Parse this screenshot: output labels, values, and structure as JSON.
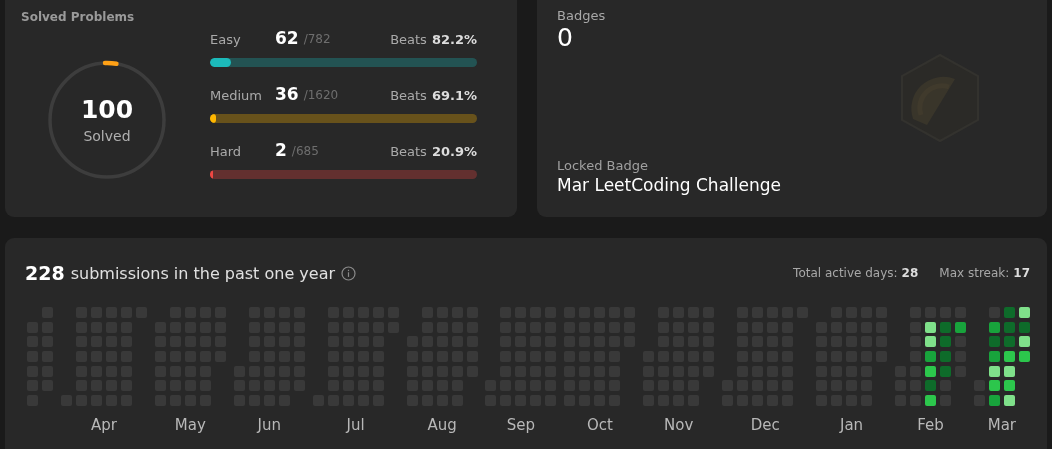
{
  "solved": {
    "title": "Solved Problems",
    "count": "100",
    "caption": "Solved",
    "level": 0.032,
    "difficulties": [
      {
        "label": "Easy",
        "count": "62",
        "total": "/782",
        "beats_label": "Beats",
        "beats": "82.2%",
        "color": "#1cbaba",
        "level": 0.08
      },
      {
        "label": "Medium",
        "count": "36",
        "total": "/1620",
        "beats_label": "Beats",
        "beats": "69.1%",
        "color": "#ffb700",
        "level": 0.022
      },
      {
        "label": "Hard",
        "count": "2",
        "total": "/685",
        "beats_label": "Beats",
        "beats": "20.9%",
        "color": "#ef4743",
        "level": 0.012
      }
    ]
  },
  "badges": {
    "title": "Badges",
    "count": "0",
    "locked_label": "Locked Badge",
    "locked_name": "Mar LeetCoding Challenge"
  },
  "submissions": {
    "count": "228",
    "text": "submissions in the past one year",
    "active_label": "Total active days:",
    "active_days": "28",
    "streak_label": "Max streak:",
    "streak": "17",
    "months": [
      {
        "weeks": [
          [
            {
              "color": "#393939"
            },
            {
              "color": "#393939"
            },
            {
              "color": "#393939"
            },
            {
              "color": "#393939"
            },
            {
              "color": "#393939"
            },
            {
              "color": "#393939"
            }
          ],
          [
            {
              "color": "#393939"
            },
            {
              "color": "#393939"
            },
            {
              "color": "#393939"
            },
            {
              "color": "#393939"
            },
            {
              "color": "#393939"
            },
            {
              "color": "#393939"
            }
          ]
        ]
      },
      {
        "label": "Apr",
        "weeks": [
          [
            {
              "color": "#393939"
            }
          ],
          [
            {
              "color": "#393939"
            },
            {
              "color": "#393939"
            },
            {
              "color": "#393939"
            },
            {
              "color": "#393939"
            },
            {
              "color": "#393939"
            },
            {
              "color": "#393939"
            },
            {
              "color": "#393939"
            }
          ],
          [
            {
              "color": "#393939"
            },
            {
              "color": "#393939"
            },
            {
              "color": "#393939"
            },
            {
              "color": "#393939"
            },
            {
              "color": "#393939"
            },
            {
              "color": "#393939"
            },
            {
              "color": "#393939"
            }
          ],
          [
            {
              "color": "#393939"
            },
            {
              "color": "#393939"
            },
            {
              "color": "#393939"
            },
            {
              "color": "#393939"
            },
            {
              "color": "#393939"
            },
            {
              "color": "#393939"
            },
            {
              "color": "#393939"
            }
          ],
          [
            {
              "color": "#393939"
            },
            {
              "color": "#393939"
            },
            {
              "color": "#393939"
            },
            {
              "color": "#393939"
            },
            {
              "color": "#393939"
            },
            {
              "color": "#393939"
            },
            {
              "color": "#393939"
            }
          ],
          [
            {
              "color": "#393939"
            }
          ]
        ]
      },
      {
        "label": "May",
        "weeks": [
          [
            {
              "color": "#393939"
            },
            {
              "color": "#393939"
            },
            {
              "color": "#393939"
            },
            {
              "color": "#393939"
            },
            {
              "color": "#393939"
            },
            {
              "color": "#393939"
            }
          ],
          [
            {
              "color": "#393939"
            },
            {
              "color": "#393939"
            },
            {
              "color": "#393939"
            },
            {
              "color": "#393939"
            },
            {
              "color": "#393939"
            },
            {
              "color": "#393939"
            },
            {
              "color": "#393939"
            }
          ],
          [
            {
              "color": "#393939"
            },
            {
              "color": "#393939"
            },
            {
              "color": "#393939"
            },
            {
              "color": "#393939"
            },
            {
              "color": "#393939"
            },
            {
              "color": "#393939"
            },
            {
              "color": "#393939"
            }
          ],
          [
            {
              "color": "#393939"
            },
            {
              "color": "#393939"
            },
            {
              "color": "#393939"
            },
            {
              "color": "#393939"
            },
            {
              "color": "#393939"
            },
            {
              "color": "#393939"
            },
            {
              "color": "#393939"
            }
          ],
          [
            {
              "color": "#393939"
            },
            {
              "color": "#393939"
            },
            {
              "color": "#393939"
            },
            {
              "color": "#393939"
            }
          ]
        ]
      },
      {
        "label": "Jun",
        "weeks": [
          [
            {
              "color": "#393939"
            },
            {
              "color": "#393939"
            },
            {
              "color": "#393939"
            }
          ],
          [
            {
              "color": "#393939"
            },
            {
              "color": "#393939"
            },
            {
              "color": "#393939"
            },
            {
              "color": "#393939"
            },
            {
              "color": "#393939"
            },
            {
              "color": "#393939"
            },
            {
              "color": "#393939"
            }
          ],
          [
            {
              "color": "#393939"
            },
            {
              "color": "#393939"
            },
            {
              "color": "#393939"
            },
            {
              "color": "#393939"
            },
            {
              "color": "#393939"
            },
            {
              "color": "#393939"
            },
            {
              "color": "#393939"
            }
          ],
          [
            {
              "color": "#393939"
            },
            {
              "color": "#393939"
            },
            {
              "color": "#393939"
            },
            {
              "color": "#393939"
            },
            {
              "color": "#393939"
            },
            {
              "color": "#393939"
            },
            {
              "color": "#393939"
            }
          ],
          [
            {
              "color": "#393939"
            },
            {
              "color": "#393939"
            },
            {
              "color": "#393939"
            },
            {
              "color": "#393939"
            },
            {
              "color": "#393939"
            },
            {
              "color": "#393939"
            }
          ]
        ]
      },
      {
        "label": "Jul",
        "weeks": [
          [
            {
              "color": "#393939"
            }
          ],
          [
            {
              "color": "#393939"
            },
            {
              "color": "#393939"
            },
            {
              "color": "#393939"
            },
            {
              "color": "#393939"
            },
            {
              "color": "#393939"
            },
            {
              "color": "#393939"
            },
            {
              "color": "#393939"
            }
          ],
          [
            {
              "color": "#393939"
            },
            {
              "color": "#393939"
            },
            {
              "color": "#393939"
            },
            {
              "color": "#393939"
            },
            {
              "color": "#393939"
            },
            {
              "color": "#393939"
            },
            {
              "color": "#393939"
            }
          ],
          [
            {
              "color": "#393939"
            },
            {
              "color": "#393939"
            },
            {
              "color": "#393939"
            },
            {
              "color": "#393939"
            },
            {
              "color": "#393939"
            },
            {
              "color": "#393939"
            },
            {
              "color": "#393939"
            }
          ],
          [
            {
              "color": "#393939"
            },
            {
              "color": "#393939"
            },
            {
              "color": "#393939"
            },
            {
              "color": "#393939"
            },
            {
              "color": "#393939"
            },
            {
              "color": "#393939"
            },
            {
              "color": "#393939"
            }
          ],
          [
            {
              "color": "#393939"
            },
            {
              "color": "#393939"
            }
          ]
        ]
      },
      {
        "label": "Aug",
        "weeks": [
          [
            {
              "color": "#393939"
            },
            {
              "color": "#393939"
            },
            {
              "color": "#393939"
            },
            {
              "color": "#393939"
            },
            {
              "color": "#393939"
            }
          ],
          [
            {
              "color": "#393939"
            },
            {
              "color": "#393939"
            },
            {
              "color": "#393939"
            },
            {
              "color": "#393939"
            },
            {
              "color": "#393939"
            },
            {
              "color": "#393939"
            },
            {
              "color": "#393939"
            }
          ],
          [
            {
              "color": "#393939"
            },
            {
              "color": "#393939"
            },
            {
              "color": "#393939"
            },
            {
              "color": "#393939"
            },
            {
              "color": "#393939"
            },
            {
              "color": "#393939"
            },
            {
              "color": "#393939"
            }
          ],
          [
            {
              "color": "#393939"
            },
            {
              "color": "#393939"
            },
            {
              "color": "#393939"
            },
            {
              "color": "#393939"
            },
            {
              "color": "#393939"
            },
            {
              "color": "#393939"
            },
            {
              "color": "#393939"
            }
          ],
          [
            {
              "color": "#393939"
            },
            {
              "color": "#393939"
            },
            {
              "color": "#393939"
            },
            {
              "color": "#393939"
            },
            {
              "color": "#393939"
            }
          ]
        ]
      },
      {
        "label": "Sep",
        "weeks": [
          [
            {
              "color": "#393939"
            },
            {
              "color": "#393939"
            }
          ],
          [
            {
              "color": "#393939"
            },
            {
              "color": "#393939"
            },
            {
              "color": "#393939"
            },
            {
              "color": "#393939"
            },
            {
              "color": "#393939"
            },
            {
              "color": "#393939"
            },
            {
              "color": "#393939"
            }
          ],
          [
            {
              "color": "#393939"
            },
            {
              "color": "#393939"
            },
            {
              "color": "#393939"
            },
            {
              "color": "#393939"
            },
            {
              "color": "#393939"
            },
            {
              "color": "#393939"
            },
            {
              "color": "#393939"
            }
          ],
          [
            {
              "color": "#393939"
            },
            {
              "color": "#393939"
            },
            {
              "color": "#393939"
            },
            {
              "color": "#393939"
            },
            {
              "color": "#393939"
            },
            {
              "color": "#393939"
            },
            {
              "color": "#393939"
            }
          ],
          [
            {
              "color": "#393939"
            },
            {
              "color": "#393939"
            },
            {
              "color": "#393939"
            },
            {
              "color": "#393939"
            },
            {
              "color": "#393939"
            },
            {
              "color": "#393939"
            },
            {
              "color": "#393939"
            }
          ]
        ]
      },
      {
        "label": "Oct",
        "weeks": [
          [
            {
              "color": "#393939"
            },
            {
              "color": "#393939"
            },
            {
              "color": "#393939"
            },
            {
              "color": "#393939"
            },
            {
              "color": "#393939"
            },
            {
              "color": "#393939"
            },
            {
              "color": "#393939"
            }
          ],
          [
            {
              "color": "#393939"
            },
            {
              "color": "#393939"
            },
            {
              "color": "#393939"
            },
            {
              "color": "#393939"
            },
            {
              "color": "#393939"
            },
            {
              "color": "#393939"
            },
            {
              "color": "#393939"
            }
          ],
          [
            {
              "color": "#393939"
            },
            {
              "color": "#393939"
            },
            {
              "color": "#393939"
            },
            {
              "color": "#393939"
            },
            {
              "color": "#393939"
            },
            {
              "color": "#393939"
            },
            {
              "color": "#393939"
            }
          ],
          [
            {
              "color": "#393939"
            },
            {
              "color": "#393939"
            },
            {
              "color": "#393939"
            },
            {
              "color": "#393939"
            },
            {
              "color": "#393939"
            },
            {
              "color": "#393939"
            },
            {
              "color": "#393939"
            }
          ],
          [
            {
              "color": "#393939"
            },
            {
              "color": "#393939"
            },
            {
              "color": "#393939"
            }
          ]
        ]
      },
      {
        "label": "Nov",
        "weeks": [
          [
            {
              "color": "#393939"
            },
            {
              "color": "#393939"
            },
            {
              "color": "#393939"
            },
            {
              "color": "#393939"
            }
          ],
          [
            {
              "color": "#393939"
            },
            {
              "color": "#393939"
            },
            {
              "color": "#393939"
            },
            {
              "color": "#393939"
            },
            {
              "color": "#393939"
            },
            {
              "color": "#393939"
            },
            {
              "color": "#393939"
            }
          ],
          [
            {
              "color": "#393939"
            },
            {
              "color": "#393939"
            },
            {
              "color": "#393939"
            },
            {
              "color": "#393939"
            },
            {
              "color": "#393939"
            },
            {
              "color": "#393939"
            },
            {
              "color": "#393939"
            }
          ],
          [
            {
              "color": "#393939"
            },
            {
              "color": "#393939"
            },
            {
              "color": "#393939"
            },
            {
              "color": "#393939"
            },
            {
              "color": "#393939"
            },
            {
              "color": "#393939"
            },
            {
              "color": "#393939"
            }
          ],
          [
            {
              "color": "#393939"
            },
            {
              "color": "#393939"
            },
            {
              "color": "#393939"
            },
            {
              "color": "#393939"
            },
            {
              "color": "#393939"
            }
          ]
        ]
      },
      {
        "label": "Dec",
        "weeks": [
          [
            {
              "color": "#393939"
            },
            {
              "color": "#393939"
            }
          ],
          [
            {
              "color": "#393939"
            },
            {
              "color": "#393939"
            },
            {
              "color": "#393939"
            },
            {
              "color": "#393939"
            },
            {
              "color": "#393939"
            },
            {
              "color": "#393939"
            },
            {
              "color": "#393939"
            }
          ],
          [
            {
              "color": "#393939"
            },
            {
              "color": "#393939"
            },
            {
              "color": "#393939"
            },
            {
              "color": "#393939"
            },
            {
              "color": "#393939"
            },
            {
              "color": "#393939"
            },
            {
              "color": "#393939"
            }
          ],
          [
            {
              "color": "#393939"
            },
            {
              "color": "#393939"
            },
            {
              "color": "#393939"
            },
            {
              "color": "#393939"
            },
            {
              "color": "#393939"
            },
            {
              "color": "#393939"
            },
            {
              "color": "#393939"
            }
          ],
          [
            {
              "color": "#393939"
            },
            {
              "color": "#393939"
            },
            {
              "color": "#393939"
            },
            {
              "color": "#393939"
            },
            {
              "color": "#393939"
            },
            {
              "color": "#393939"
            },
            {
              "color": "#393939"
            }
          ],
          [
            {
              "color": "#393939"
            }
          ]
        ]
      },
      {
        "label": "Jan",
        "weeks": [
          [
            {
              "color": "#393939"
            },
            {
              "color": "#393939"
            },
            {
              "color": "#393939"
            },
            {
              "color": "#393939"
            },
            {
              "color": "#393939"
            },
            {
              "color": "#393939"
            }
          ],
          [
            {
              "color": "#393939"
            },
            {
              "color": "#393939"
            },
            {
              "color": "#393939"
            },
            {
              "color": "#393939"
            },
            {
              "color": "#393939"
            },
            {
              "color": "#393939"
            },
            {
              "color": "#393939"
            }
          ],
          [
            {
              "color": "#393939"
            },
            {
              "color": "#393939"
            },
            {
              "color": "#393939"
            },
            {
              "color": "#393939"
            },
            {
              "color": "#393939"
            },
            {
              "color": "#393939"
            },
            {
              "color": "#393939"
            }
          ],
          [
            {
              "color": "#393939"
            },
            {
              "color": "#393939"
            },
            {
              "color": "#393939"
            },
            {
              "color": "#393939"
            },
            {
              "color": "#393939"
            },
            {
              "color": "#393939"
            },
            {
              "color": "#393939"
            }
          ],
          [
            {
              "color": "#393939"
            },
            {
              "color": "#393939"
            },
            {
              "color": "#393939"
            },
            {
              "color": "#393939"
            }
          ]
        ]
      },
      {
        "label": "Feb",
        "weeks": [
          [
            {
              "color": "#393939"
            },
            {
              "color": "#393939"
            },
            {
              "color": "#393939"
            }
          ],
          [
            {
              "color": "#393939"
            },
            {
              "color": "#393939"
            },
            {
              "color": "#393939"
            },
            {
              "color": "#393939"
            },
            {
              "color": "#393939"
            },
            {
              "color": "#393939"
            },
            {
              "color": "#393939"
            }
          ],
          [
            {
              "color": "#393939"
            },
            {
              "color": "#7fe08a"
            },
            {
              "color": "#7fe08a"
            },
            {
              "color": "#18a33c"
            },
            {
              "color": "#2cc64c"
            },
            {
              "color": "#0e6b2a"
            },
            {
              "color": "#2cc64c"
            }
          ],
          [
            {
              "color": "#393939"
            },
            {
              "color": "#0e6b2a"
            },
            {
              "color": "#0e6b2a"
            },
            {
              "color": "#0e6b2a"
            },
            {
              "color": "#0e6b2a"
            },
            {
              "color": "#393939"
            },
            {
              "color": "#393939"
            }
          ],
          [
            {
              "color": "#393939"
            },
            {
              "color": "#18a33c"
            },
            {
              "color": "#393939"
            },
            {
              "color": "#393939"
            },
            {
              "color": "#393939"
            }
          ]
        ]
      },
      {
        "label": "Mar",
        "weeks": [
          [
            {
              "color": "#393939"
            },
            {
              "color": "#393939"
            }
          ],
          [
            {
              "color": "#393939"
            },
            {
              "color": "#18a33c"
            },
            {
              "color": "#0e6b2a"
            },
            {
              "color": "#18a33c"
            },
            {
              "color": "#7fe08a"
            },
            {
              "color": "#2cc64c"
            },
            {
              "color": "#18a33c"
            }
          ],
          [
            {
              "color": "#0e6b2a"
            },
            {
              "color": "#0e6b2a"
            },
            {
              "color": "#0e6b2a"
            },
            {
              "color": "#2cc64c"
            },
            {
              "color": "#7fe08a"
            },
            {
              "color": "#2cc64c"
            },
            {
              "color": "#7fe08a"
            }
          ],
          [
            {
              "color": "#7fe08a"
            },
            {
              "color": "#0e6b2a"
            },
            {
              "color": "#7fe08a"
            },
            {
              "color": "#2cc64c"
            }
          ]
        ]
      }
    ]
  }
}
